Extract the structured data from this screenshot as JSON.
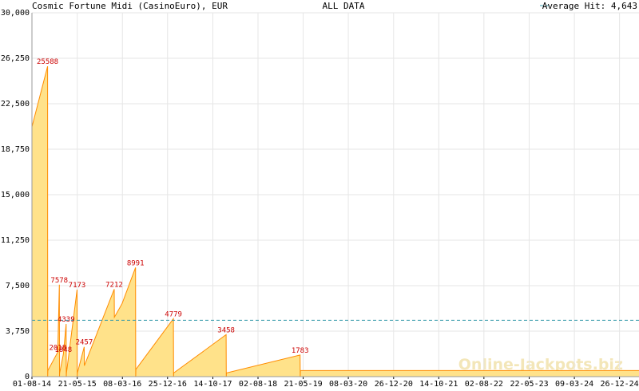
{
  "header": {
    "title": "Cosmic Fortune Midi (CasinoEuro), EUR",
    "center": "ALL DATA",
    "legend": "Average Hit: 4,643"
  },
  "watermark": "Online-Jackpots.biz",
  "colors": {
    "fill": "#ffe28a",
    "line": "#ff8c00",
    "average": "#3399aa",
    "peak_label": "#cc0000",
    "grid": "#e6e6e6"
  },
  "chart_data": {
    "type": "area",
    "title": "Cosmic Fortune Midi (CasinoEuro), EUR",
    "subtitle": "ALL DATA",
    "ylim": [
      0,
      30000
    ],
    "yticks": [
      "0",
      "3,750",
      "7,500",
      "11,250",
      "15,000",
      "18,750",
      "22,500",
      "26,250",
      "30,000"
    ],
    "yticks_values": [
      0,
      3750,
      7500,
      11250,
      15000,
      18750,
      22500,
      26250,
      30000
    ],
    "xticks": [
      "01-08-14",
      "21-05-15",
      "08-03-16",
      "25-12-16",
      "14-10-17",
      "02-08-18",
      "21-05-19",
      "08-03-20",
      "26-12-20",
      "14-10-21",
      "02-08-22",
      "22-05-23",
      "09-03-24",
      "26-12-24"
    ],
    "x_start": "2014-08-01",
    "x_end": "2025-05-01",
    "grid": true,
    "average_hit": 4643,
    "series": [
      {
        "points": [
          [
            "2014-08-01",
            20600
          ],
          [
            "2014-11-10",
            25588
          ],
          [
            "2014-11-11",
            0
          ],
          [
            "2014-11-12",
            500
          ],
          [
            "2015-01-15",
            2018
          ],
          [
            "2015-01-25",
            7578
          ],
          [
            "2015-01-26",
            0
          ],
          [
            "2015-01-27",
            300
          ],
          [
            "2015-02-20",
            1848
          ],
          [
            "2015-03-10",
            4339
          ],
          [
            "2015-03-11",
            0
          ],
          [
            "2015-03-12",
            300
          ],
          [
            "2015-05-20",
            7173
          ],
          [
            "2015-05-21",
            0
          ],
          [
            "2015-05-22",
            300
          ],
          [
            "2015-07-05",
            2457
          ],
          [
            "2015-07-06",
            900
          ],
          [
            "2016-01-15",
            7212
          ],
          [
            "2016-01-16",
            4900
          ],
          [
            "2016-03-05",
            6000
          ],
          [
            "2016-06-01",
            8991
          ],
          [
            "2016-06-02",
            0
          ],
          [
            "2016-06-03",
            600
          ],
          [
            "2017-02-01",
            4779
          ],
          [
            "2017-02-02",
            0
          ],
          [
            "2017-02-03",
            300
          ],
          [
            "2018-01-08",
            3458
          ],
          [
            "2018-01-09",
            0
          ],
          [
            "2018-01-10",
            300
          ],
          [
            "2019-05-01",
            1783
          ],
          [
            "2019-05-02",
            0
          ],
          [
            "2019-05-03",
            500
          ],
          [
            "2025-05-01",
            500
          ]
        ]
      }
    ],
    "annotations": [
      {
        "label": "25588",
        "x": "2014-11-10",
        "y": 25588
      },
      {
        "label": "7578",
        "x": "2015-01-25",
        "y": 7578
      },
      {
        "label": "2018",
        "x": "2015-01-15",
        "y": 2018
      },
      {
        "label": "1848",
        "x": "2015-02-20",
        "y": 1848
      },
      {
        "label": "4339",
        "x": "2015-03-10",
        "y": 4339
      },
      {
        "label": "7173",
        "x": "2015-05-20",
        "y": 7173
      },
      {
        "label": "2457",
        "x": "2015-07-05",
        "y": 2457
      },
      {
        "label": "7212",
        "x": "2016-01-15",
        "y": 7212
      },
      {
        "label": "8991",
        "x": "2016-06-01",
        "y": 8991
      },
      {
        "label": "4779",
        "x": "2017-02-01",
        "y": 4779
      },
      {
        "label": "3458",
        "x": "2018-01-08",
        "y": 3458
      },
      {
        "label": "1783",
        "x": "2019-05-01",
        "y": 1783
      }
    ]
  }
}
